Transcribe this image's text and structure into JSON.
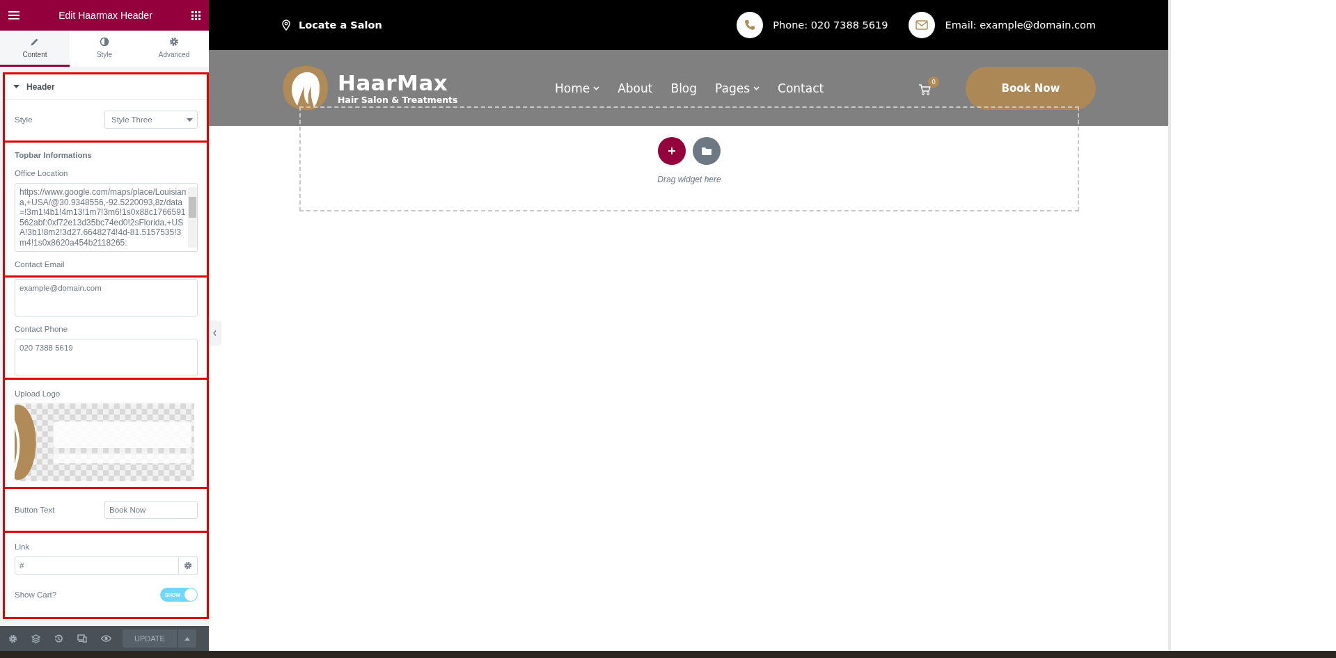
{
  "editor": {
    "title": "Edit Haarmax Header",
    "tabs": [
      {
        "label": "Content",
        "selected": true
      },
      {
        "label": "Style",
        "selected": false
      },
      {
        "label": "Advanced",
        "selected": false
      }
    ],
    "section": {
      "title": "Header",
      "expanded": true
    },
    "style_field": {
      "label": "Style",
      "value": "Style Three"
    },
    "group_title": "Topbar Informations",
    "office_location": {
      "label": "Office Location",
      "value": "https://www.google.com/maps/place/Louisiana,+USA/@30.9348556,-92.5220093,8z/data=!3m1!4b1!4m13!1m7!3m6!1s0x88c1766591562abf:0xf72e13d35bc74ed0!2sFlorida,+USA!3b1!8m2!3d27.6648274!4d-81.5157535!3m4!1s0x8620a454b2118265:"
    },
    "contact_email": {
      "label": "Contact Email",
      "value": "example@domain.com"
    },
    "contact_phone": {
      "label": "Contact Phone",
      "value": "020 7388 5619"
    },
    "upload_logo": {
      "label": "Upload Logo",
      "kind": "picture"
    },
    "button_text": {
      "label": "Button Text",
      "value": "Book Now"
    },
    "link": {
      "label": "Link",
      "value": "#"
    },
    "show_cart": {
      "label": "Show Cart?",
      "on": true,
      "text": "SHOW"
    },
    "footer": {
      "update_label": "UPDATE"
    }
  },
  "page": {
    "topbar": {
      "location": "Locate a Salon",
      "phone": "Phone: 020 7388 5619",
      "email": "Email: example@domain.com"
    },
    "header": {
      "brand": "HaarMax",
      "tagline": "Hair Salon & Treatments",
      "nav": [
        {
          "label": "Home",
          "has_submenu": true
        },
        {
          "label": "About",
          "has_submenu": false
        },
        {
          "label": "Blog",
          "has_submenu": false
        },
        {
          "label": "Pages",
          "has_submenu": true
        },
        {
          "label": "Contact",
          "has_submenu": false
        }
      ],
      "cart_count": "0",
      "cta": "Book Now"
    },
    "dropzone": {
      "hint": "Drag widget here"
    }
  }
}
